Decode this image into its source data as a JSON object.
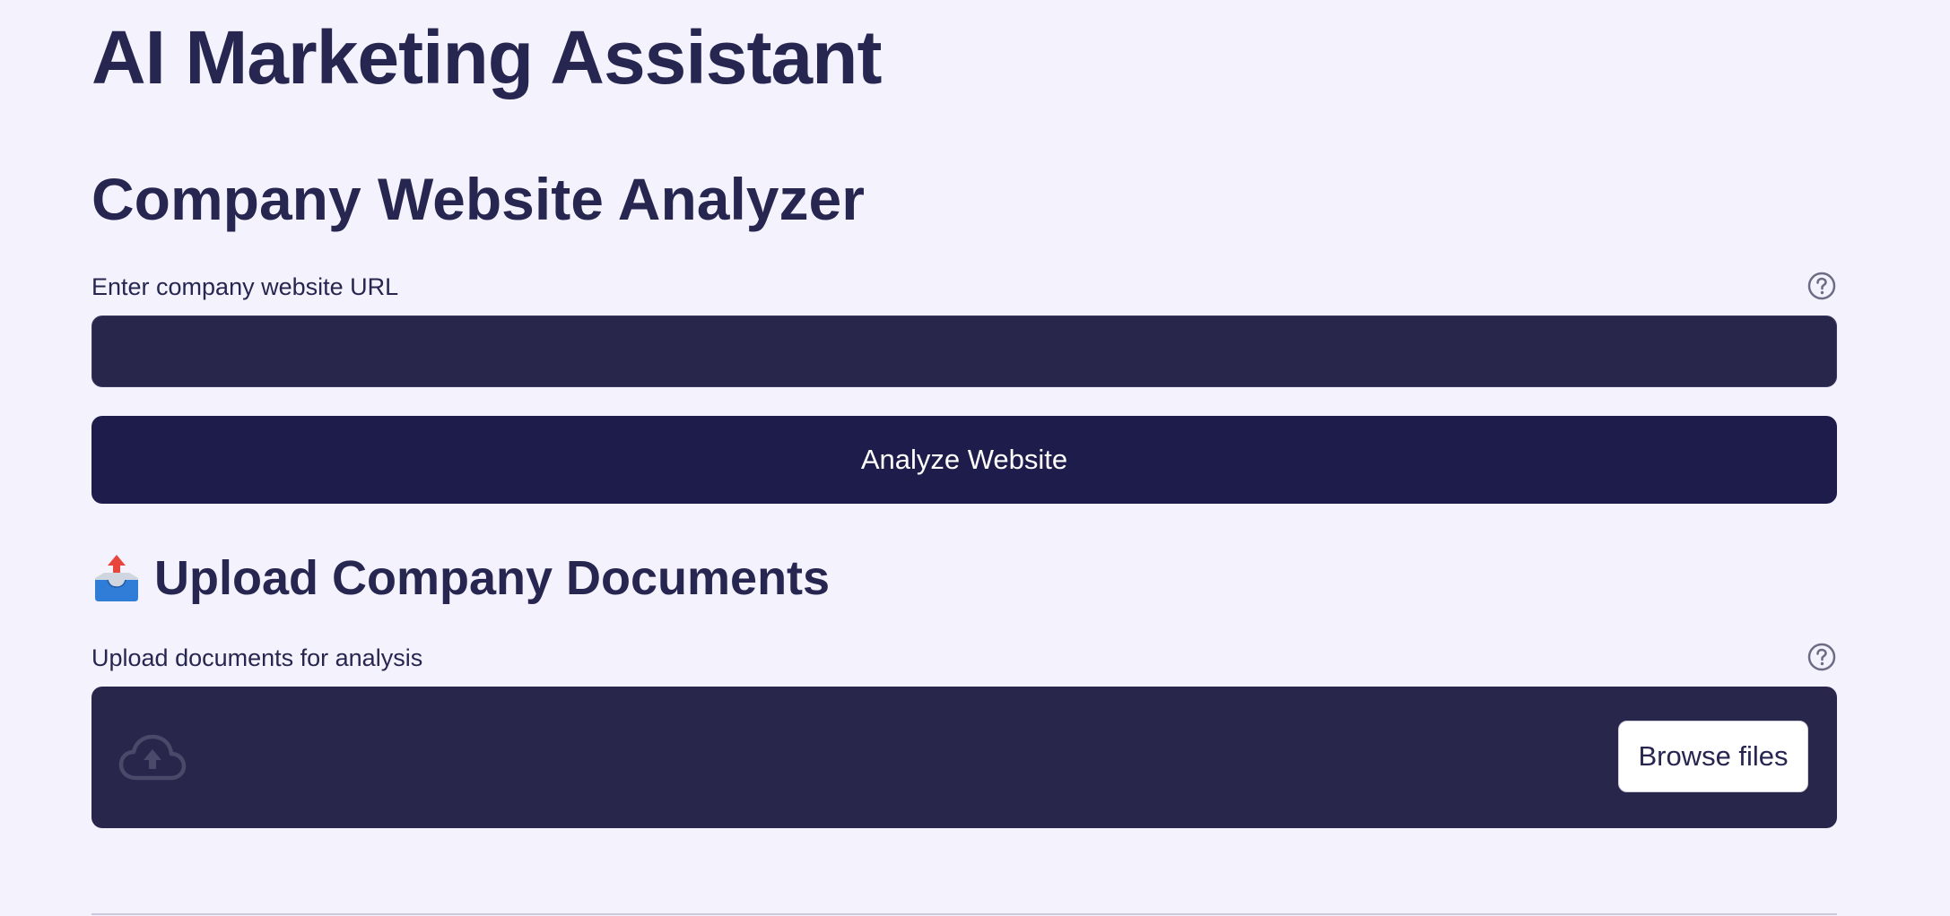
{
  "header": {
    "title": "AI Marketing Assistant"
  },
  "analyzer": {
    "heading": "Company Website Analyzer",
    "url_label": "Enter company website URL",
    "url_value": "",
    "url_placeholder": "",
    "help_icon": "question-circle-icon",
    "analyze_button_label": "Analyze Website"
  },
  "upload": {
    "heading_icon": "outbox-tray-icon",
    "heading": "Upload Company Documents",
    "label": "Upload documents for analysis",
    "help_icon": "question-circle-icon",
    "dropzone_icon": "cloud-upload-icon",
    "browse_button_label": "Browse files"
  },
  "colors": {
    "background": "#F3F2FD",
    "text": "#262650",
    "input_background": "#28264A",
    "button_background": "#1E1C4B"
  }
}
